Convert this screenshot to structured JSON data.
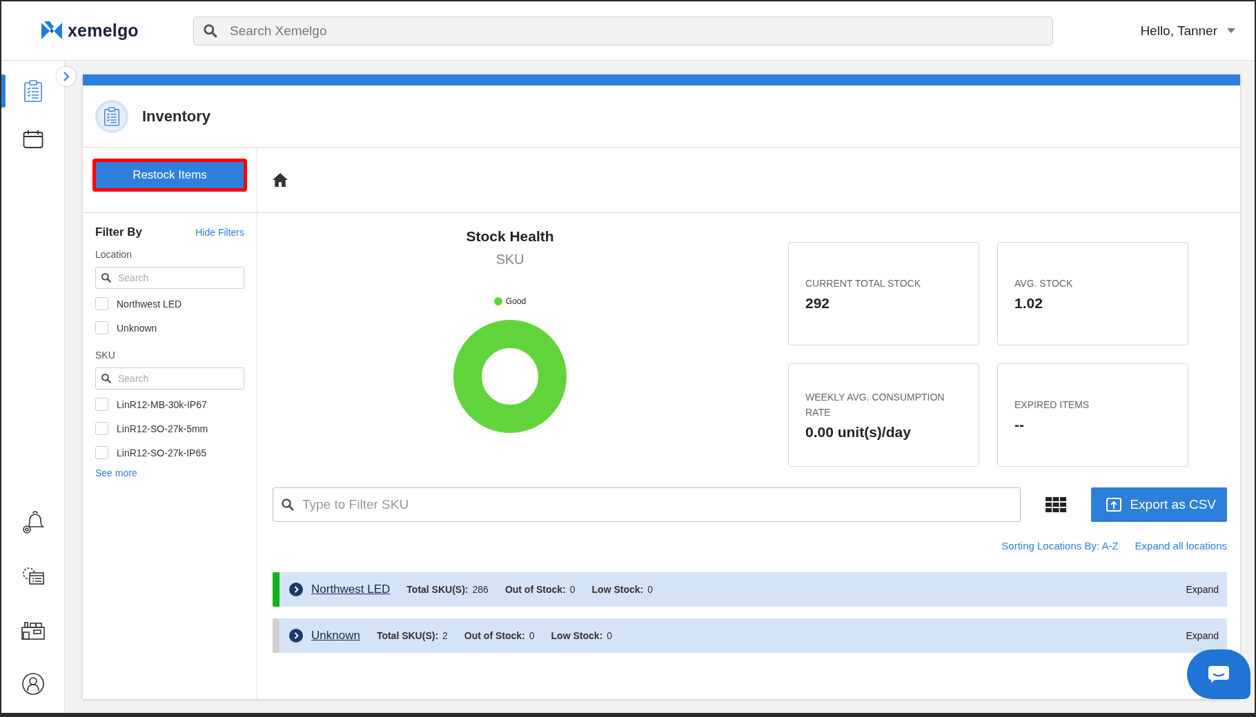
{
  "header": {
    "logo": "xemelgo",
    "search": {
      "placeholder": "Search Xemelgo"
    },
    "user": "Hello, Tanner"
  },
  "nav": {
    "top": [
      {
        "selected": true
      },
      {
        "selected": false
      }
    ],
    "bottom": [
      {
        "selected": false
      },
      {
        "selected": false
      },
      {
        "selected": false
      },
      {
        "selected": false
      }
    ]
  },
  "page": {
    "title": "Inventory",
    "restock_button": "Restock Items",
    "filters": {
      "title": "Filter By",
      "hide_link": "Hide Filters",
      "groups": [
        {
          "label": "Location",
          "search": {
            "placeholder": "Search"
          },
          "options": [
            {
              "label": "Northwest LED",
              "checked": false
            },
            {
              "label": "Unknown",
              "checked": false
            }
          ]
        },
        {
          "label": "SKU",
          "search": {
            "placeholder": "Search"
          },
          "options": [
            {
              "label": "LinR12-MB-30k-IP67",
              "checked": false
            },
            {
              "label": "LinR12-SO-27k-5mm",
              "checked": false
            },
            {
              "label": "LinR12-SO-27k-IP65",
              "checked": false
            }
          ],
          "see_more": "See more"
        }
      ]
    },
    "stock_health": {
      "title": "Stock Health",
      "subtitle": "SKU",
      "legend": [
        {
          "label": "Good",
          "color": "#62d43b"
        }
      ]
    },
    "stats": [
      {
        "label": "CURRENT TOTAL STOCK",
        "value": "292"
      },
      {
        "label": "AVG. STOCK",
        "value": "1.02"
      },
      {
        "label": "WEEKLY AVG. CONSUMPTION RATE",
        "value": "0.00 unit(s)/day"
      },
      {
        "label": "EXPIRED ITEMS",
        "value": "--"
      }
    ],
    "sku_filter": {
      "placeholder": "Type to Filter SKU"
    },
    "export_button": "Export as CSV",
    "sort_link": "Sorting Locations By: A-Z",
    "expand_all_link": "Expand all locations",
    "locations": [
      {
        "name": "Northwest LED",
        "color": "#10b31a",
        "stats": [
          {
            "label": "Total SKU(S):",
            "value": "286"
          },
          {
            "label": "Out of Stock:",
            "value": "0"
          },
          {
            "label": "Low Stock:",
            "value": "0"
          }
        ],
        "expand": "Expand"
      },
      {
        "name": "Unknown",
        "color": "#cfcfcf",
        "stats": [
          {
            "label": "Total SKU(S):",
            "value": "2"
          },
          {
            "label": "Out of Stock:",
            "value": "0"
          },
          {
            "label": "Low Stock:",
            "value": "0"
          }
        ],
        "expand": "Expand"
      }
    ]
  }
}
